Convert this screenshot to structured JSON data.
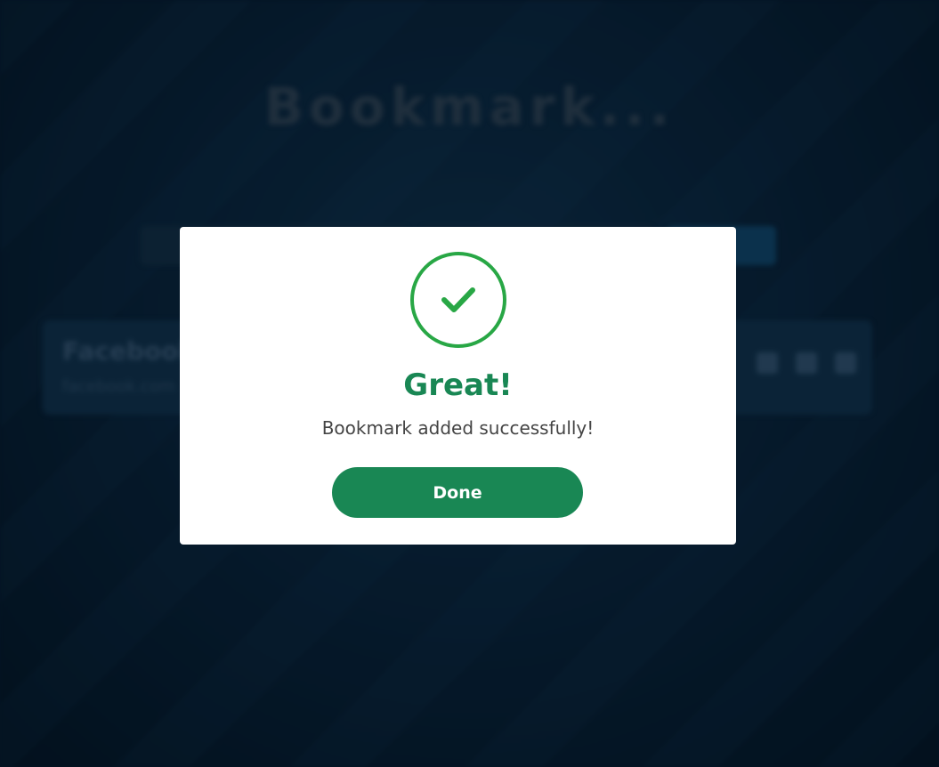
{
  "app": {
    "title": "Bookmark...",
    "card": {
      "name": "Facebook",
      "url": "facebook.com"
    }
  },
  "modal": {
    "icon": "check-circle-icon",
    "title": "Great!",
    "message": "Bookmark added successfully!",
    "button_label": "Done"
  },
  "colors": {
    "success": "#198754",
    "icon_ring": "#28a745",
    "background": "#06182a"
  }
}
